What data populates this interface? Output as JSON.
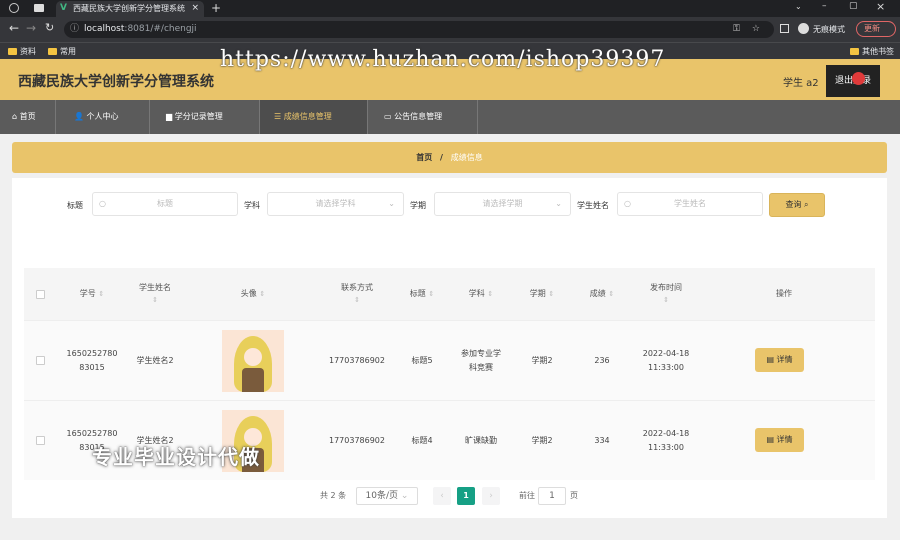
{
  "browser": {
    "tab_title": "西藏民族大学创新学分管理系统",
    "url_host": "localhost",
    "url_path": ":8081/#/chengji",
    "bookmarks": [
      "资料",
      "常用"
    ],
    "other_bookmarks": "其他书签",
    "incognito_label": "无痕模式",
    "update_label": "更新"
  },
  "header": {
    "title": "西藏民族大学创新学分管理系统",
    "user": "学生 a2",
    "logout": "退出登录"
  },
  "nav": {
    "items": [
      "首页",
      "个人中心",
      "学分记录管理",
      "成绩信息管理",
      "公告信息管理"
    ],
    "active": "成绩信息管理"
  },
  "breadcrumb": {
    "home": "首页",
    "sep": "/",
    "current": "成绩信息"
  },
  "filters": {
    "title_label": "标题",
    "title_placeholder": "标题",
    "subject_label": "学科",
    "subject_placeholder": "请选择学科",
    "term_label": "学期",
    "term_placeholder": "请选择学期",
    "name_label": "学生姓名",
    "name_placeholder": "学生姓名",
    "query": "查询"
  },
  "table": {
    "headers": {
      "id": "学号",
      "name": "学生姓名",
      "avatar": "头像",
      "phone": "联系方式",
      "title": "标题",
      "subject": "学科",
      "term": "学期",
      "score": "成绩",
      "time": "发布时间",
      "ops": "操作"
    },
    "rows": [
      {
        "id": "165025278083015",
        "name": "学生姓名2",
        "phone": "17703786902",
        "title": "标题5",
        "subject": "参加专业学科竞赛",
        "term": "学期2",
        "score": "236",
        "date": "2022-04-18",
        "clock": "11:33:00",
        "action": "详情"
      },
      {
        "id": "165025278083015",
        "name": "学生姓名2",
        "phone": "17703786902",
        "title": "标题4",
        "subject": "旷课缺勤",
        "term": "学期2",
        "score": "334",
        "date": "2022-04-18",
        "clock": "11:33:00",
        "action": "详情"
      }
    ]
  },
  "pagination": {
    "total": "共 2 条",
    "size": "10条/页",
    "page": "1",
    "goto": "前往",
    "goto_value": "1",
    "unit": "页"
  },
  "watermark": {
    "url": "https://www.huzhan.com/ishop39397",
    "slogan": "专业毕业设计代做"
  }
}
